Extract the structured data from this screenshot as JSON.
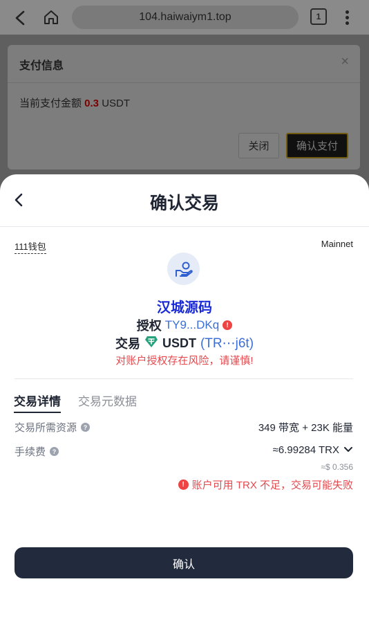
{
  "browser": {
    "url": "104.haiwaiym1.top",
    "tab_count": "1",
    "icons": {
      "back": "chevron-left-icon",
      "home": "home-icon",
      "menu": "more-vertical-icon"
    }
  },
  "payment_dialog": {
    "title": "支付信息",
    "close_symbol": "×",
    "amount_prefix": "当前支付金额 ",
    "amount_value": "0.3",
    "amount_unit": " USDT",
    "close_label": "关闭",
    "confirm_label": "确认支付"
  },
  "sheet": {
    "title": "确认交易",
    "wallet_name": "111钱包",
    "network": "Mainnet",
    "watermark": "汉城源码",
    "auth_label": "授权",
    "auth_address": "TY9...DKq",
    "tx_label": "交易",
    "tx_token": "USDT",
    "tx_address": "(TR⋯j6t)",
    "risk_warning": "对账户授权存在风险，请谨慎!",
    "tabs": {
      "details": "交易详情",
      "metadata": "交易元数据"
    },
    "resources_label": "交易所需资源",
    "resources_value": "349 带宽 + 23K 能量",
    "fee_label": "手续费",
    "fee_value": "≈6.99284 TRX",
    "fee_usd": "≈$ 0.356",
    "balance_warning": "账户可用 TRX 不足，交易可能失败",
    "confirm_label": "确认"
  },
  "colors": {
    "accent_blue": "#3b6fd6",
    "warning_red": "#e5484d",
    "dark_button": "#222b3e",
    "watermark_blue": "#1a2bd6"
  }
}
